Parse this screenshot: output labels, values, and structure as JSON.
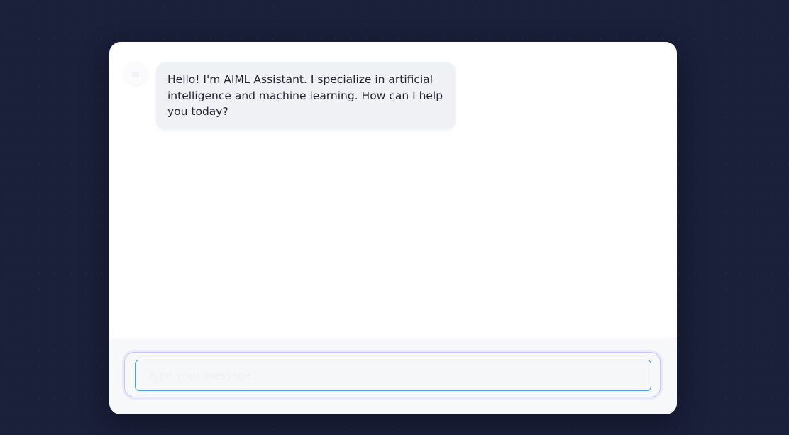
{
  "chat": {
    "messages": [
      {
        "sender": "assistant",
        "text": "Hello! I'm AIML Assistant. I specialize in artificial intelligence and machine learning. How can I help you today?"
      }
    ]
  },
  "composer": {
    "placeholder": "Type your message...",
    "value": ""
  },
  "icons": {
    "avatar": "robot-avatar-icon"
  },
  "colors": {
    "background": "#1a1f3a",
    "card": "#ffffff",
    "bubble": "#f0f1f5",
    "input_focus": "#4a9fe0",
    "input_ring": "#c9c3ff"
  }
}
